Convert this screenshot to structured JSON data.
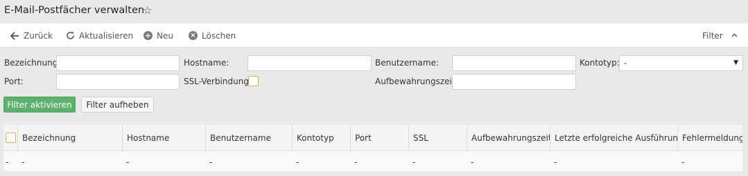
{
  "title": "E-Mail-Postfächer verwalten",
  "toolbar": {
    "back_label": "Zurück",
    "refresh_label": "Aktualisieren",
    "new_label": "Neu",
    "delete_label": "Löschen",
    "filter_label": "Filter"
  },
  "filter": {
    "bezeichnung_label": "Bezeichnung:",
    "bezeichnung_value": "",
    "hostname_label": "Hostname:",
    "hostname_value": "",
    "benutzername_label": "Benutzername:",
    "benutzername_value": "",
    "kontotyp_label": "Kontotyp:",
    "kontotyp_value": "-",
    "port_label": "Port:",
    "port_value": "",
    "ssl_label": "SSL-Verbindung:",
    "ssl_checked": false,
    "aufbewahrung_label": "Aufbewahrungszeit:",
    "aufbewahrung_value": "",
    "apply_label": "Filter aktivieren",
    "reset_label": "Filter aufheben"
  },
  "grid": {
    "columns": [
      "Bezeichnung",
      "Hostname",
      "Benutzername",
      "Kontotyp",
      "Port",
      "SSL",
      "Aufbewahrungszeit",
      "Letzte erfolgreiche Ausführung",
      "Fehlermeldung"
    ],
    "row": [
      "-",
      "-",
      "-",
      "-",
      "-",
      "-",
      "-",
      "-",
      "-",
      "-"
    ]
  },
  "colors": {
    "primary_button": "#5cb26a",
    "checkbox_border": "#e2b24a"
  },
  "icons": {
    "favorite": "star-icon",
    "back": "arrow-left-icon",
    "refresh": "refresh-icon",
    "new": "plus-circle-icon",
    "delete": "x-circle-icon",
    "collapse": "chevron-up-icon",
    "select": "chevron-down-icon"
  }
}
